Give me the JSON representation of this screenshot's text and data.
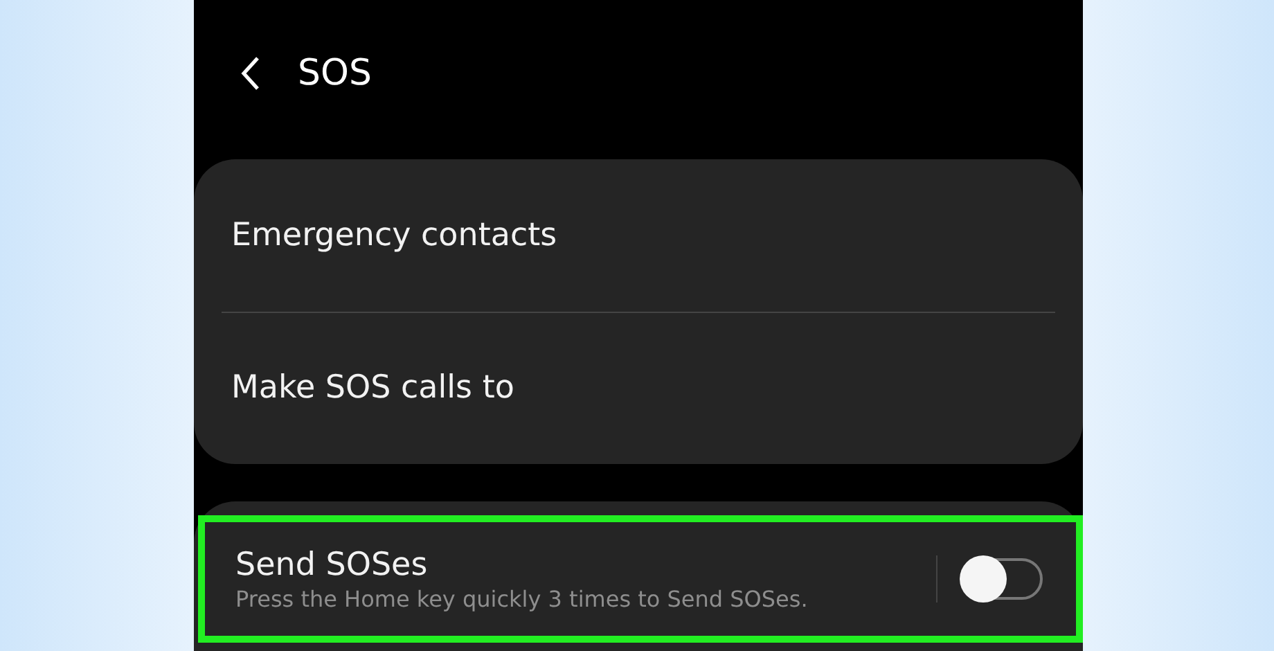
{
  "header": {
    "title": "SOS"
  },
  "menu_items": [
    {
      "label": "Emergency contacts"
    },
    {
      "label": "Make SOS calls to"
    }
  ],
  "toggle_setting": {
    "title": "Send SOSes",
    "description": "Press the Home key quickly 3 times to Send SOSes.",
    "on": false,
    "highlighted": true
  }
}
